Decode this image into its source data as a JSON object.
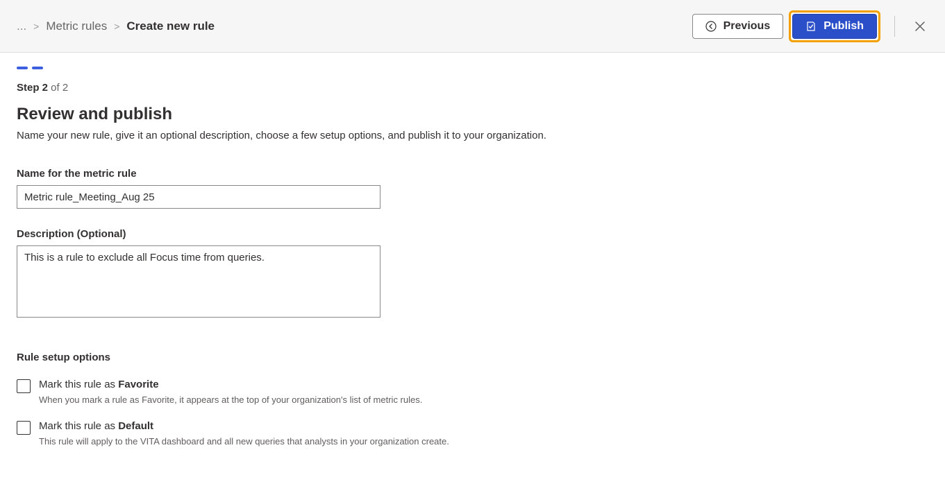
{
  "breadcrumb": {
    "ellipsis": "...",
    "link": "Metric rules",
    "current": "Create new rule"
  },
  "actions": {
    "previous": "Previous",
    "publish": "Publish"
  },
  "step": {
    "prefix": "Step 2",
    "suffix": " of 2"
  },
  "page": {
    "title": "Review and publish",
    "subtitle": "Name your new rule, give it an optional description, choose a few setup options, and publish it to your organization."
  },
  "fields": {
    "name_label": "Name for the metric rule",
    "name_value": "Metric rule_Meeting_Aug 25",
    "desc_label": "Description (Optional)",
    "desc_value": "This is a rule to exclude all Focus time from queries."
  },
  "setup": {
    "title": "Rule setup options",
    "opt1_prefix": "Mark this rule as ",
    "opt1_bold": "Favorite",
    "opt1_hint": "When you mark a rule as Favorite, it appears at the top of your organization's list of metric rules.",
    "opt2_prefix": "Mark this rule as ",
    "opt2_bold": "Default",
    "opt2_hint": "This rule will apply to the VITA dashboard and all new queries that analysts in your organization create."
  }
}
